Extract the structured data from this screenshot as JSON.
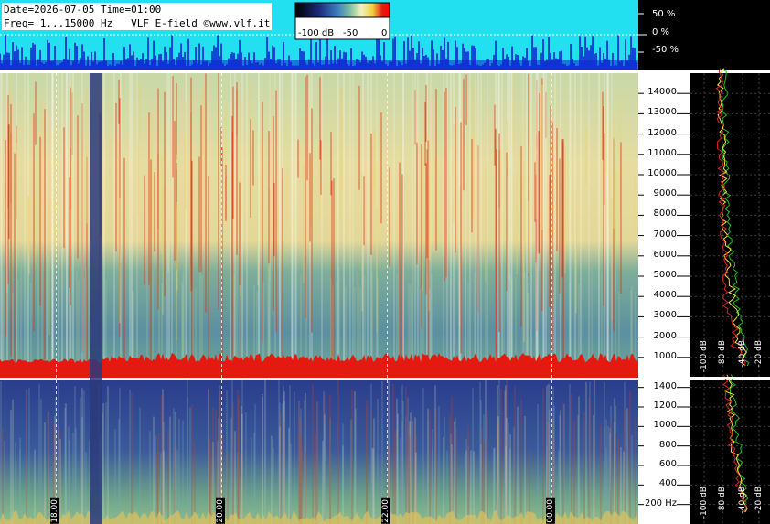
{
  "header": {
    "date_line": "Date=2026-07-05 Time=01:00",
    "freq_line": "Freq= 1...15000 Hz   VLF E-field ©www.vlf.it"
  },
  "colorscale": {
    "labels": [
      "-100 dB",
      "-50",
      "0"
    ],
    "stops": [
      "#000000",
      "#1b2a7a",
      "#3f7fbf",
      "#7fbf9f",
      "#f4f0c0",
      "#f0d040",
      "#e02010",
      "#ff0000"
    ]
  },
  "amplitude_panel": {
    "labels": [
      "50 %",
      "0 %",
      "-50 %"
    ],
    "background": "#22e0f0",
    "trace_color": "#1020d0"
  },
  "chart_data": [
    {
      "type": "heatmap",
      "title": "",
      "panel": "spectrogram-upper",
      "y_unit": "Hz",
      "ylim": [
        0,
        15000
      ],
      "y_ticks": [
        1000,
        2000,
        3000,
        4000,
        5000,
        6000,
        7000,
        8000,
        9000,
        10000,
        11000,
        12000,
        13000,
        14000
      ],
      "y_tick_labels": [
        "1000",
        "2000",
        "3000",
        "4000",
        "5000",
        "6000",
        "7000",
        "8000",
        "9000",
        "10000",
        "11000",
        "12000",
        "13000",
        "14000"
      ],
      "x_tick_labels": [
        "18.00",
        "20.00",
        "22.00",
        "00.00"
      ],
      "palette": [
        "#2e4a8a",
        "#5f9a8a",
        "#9fc49a",
        "#e8e4a8",
        "#f0d060",
        "#e03010"
      ]
    },
    {
      "type": "heatmap",
      "title": "",
      "panel": "spectrogram-lower",
      "y_unit": "Hz",
      "ylim": [
        0,
        1500
      ],
      "y_ticks": [
        200,
        400,
        600,
        800,
        1000,
        1200,
        1400
      ],
      "y_tick_labels": [
        "200 Hz",
        "400",
        "600",
        "800",
        "1000",
        "1200",
        "1400"
      ]
    },
    {
      "type": "line",
      "panel": "spectrum-profile-upper",
      "x_tick_labels": [
        "-100 dB",
        "-80 dB",
        "-40 dB",
        "-20 dB"
      ],
      "series": [
        {
          "color": "#20c020",
          "values": [
            -30,
            -33,
            -38,
            -42,
            -45,
            -48,
            -50,
            -52,
            -54,
            -55,
            -56,
            -56,
            -57,
            -58,
            -58
          ]
        },
        {
          "color": "#f0e040",
          "values": [
            -32,
            -40,
            -44,
            -48,
            -52,
            -54,
            -56,
            -57,
            -58,
            -59,
            -60,
            -60,
            -61,
            -62,
            -62
          ]
        },
        {
          "color": "#e02020",
          "values": [
            -35,
            -45,
            -50,
            -55,
            -57,
            -58,
            -59,
            -60,
            -61,
            -61,
            -62,
            -62,
            -63,
            -63,
            -64
          ]
        }
      ]
    },
    {
      "type": "line",
      "panel": "spectrum-profile-lower",
      "x_tick_labels": [
        "-100 dB",
        "-80 dB",
        "-40 dB",
        "-20 dB"
      ],
      "series": [
        {
          "color": "#20c020",
          "values": [
            -30,
            -34,
            -38,
            -40,
            -43,
            -46,
            -48
          ]
        },
        {
          "color": "#f0e040",
          "values": [
            -32,
            -38,
            -42,
            -46,
            -48,
            -50,
            -52
          ]
        },
        {
          "color": "#e02020",
          "values": [
            -34,
            -40,
            -44,
            -48,
            -50,
            -52,
            -54
          ]
        }
      ]
    }
  ]
}
